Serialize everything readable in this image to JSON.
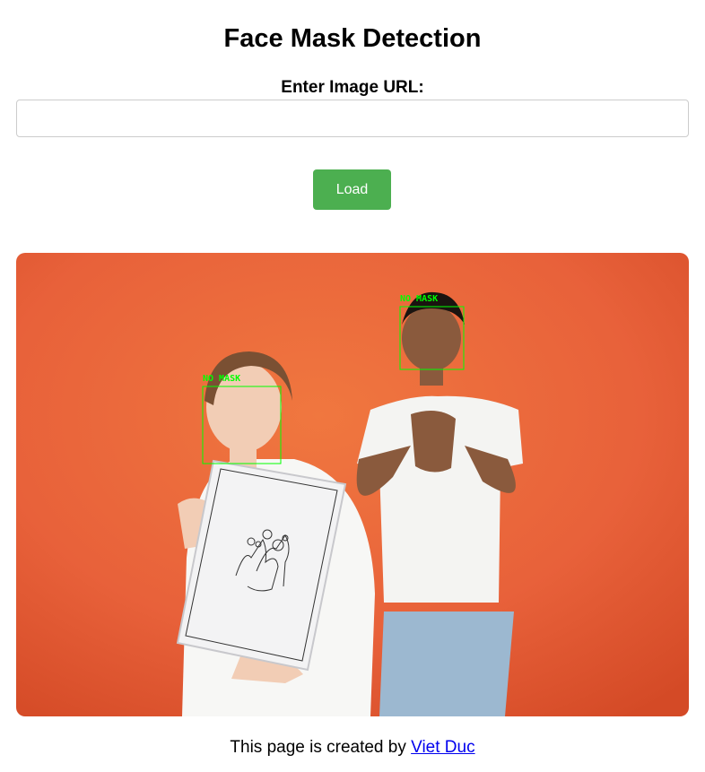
{
  "header": {
    "title": "Face Mask Detection"
  },
  "form": {
    "url_label": "Enter Image URL:",
    "url_value": "",
    "load_label": "Load"
  },
  "result": {
    "detections": [
      {
        "label": "NO MASK",
        "color": "#00ff00"
      },
      {
        "label": "NO MASK",
        "color": "#00ff00"
      }
    ]
  },
  "footer": {
    "text": "This page is created by ",
    "author_link": "Viet Duc"
  },
  "colors": {
    "accent": "#4caf50",
    "background_photo": "#e8613a",
    "detection_box": "#00ff00",
    "link": "#0000ee"
  }
}
